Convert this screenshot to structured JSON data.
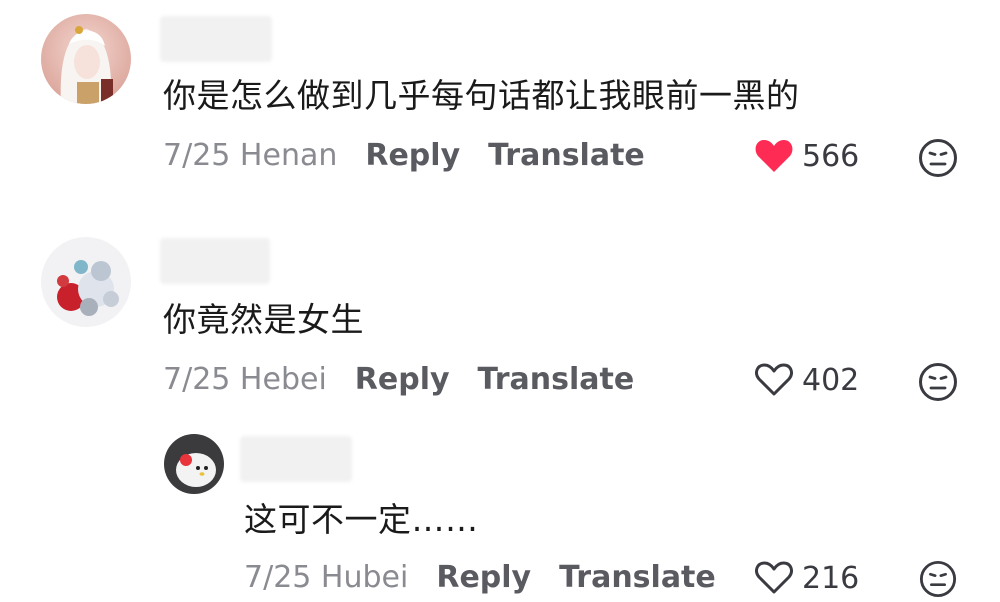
{
  "comments": [
    {
      "text": "你是怎么做到几乎每句话都让我眼前一黑的",
      "date": "7/25",
      "location": "Henan",
      "reply_label": "Reply",
      "translate_label": "Translate",
      "likes": "566",
      "liked": true
    },
    {
      "text": "你竟然是女生",
      "date": "7/25",
      "location": "Hebei",
      "reply_label": "Reply",
      "translate_label": "Translate",
      "likes": "402",
      "liked": false
    },
    {
      "text": "这可不一定……",
      "date": "7/25",
      "location": "Hubei",
      "reply_label": "Reply",
      "translate_label": "Translate",
      "likes": "216",
      "liked": false
    }
  ],
  "colors": {
    "liked_heart": "#fe2c55",
    "meta_gray": "#8a8b91",
    "action_gray": "#5a5b61"
  },
  "icons": {
    "like": "heart-icon",
    "dislike": "neutral-face-icon"
  }
}
